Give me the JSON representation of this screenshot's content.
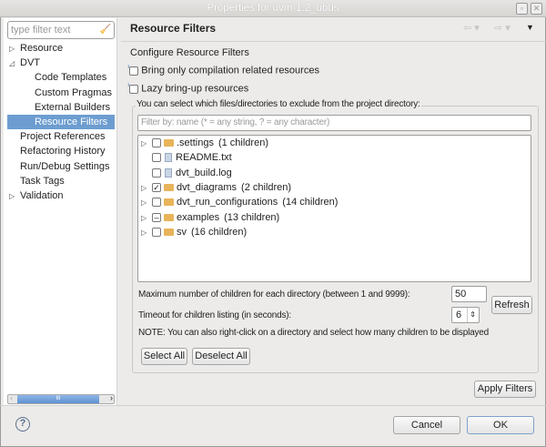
{
  "window": {
    "title": "Properties for uvm-1.2_ubus"
  },
  "sidebar": {
    "filter_placeholder": "type filter text",
    "items": [
      {
        "label": "Resource",
        "expandable": true
      },
      {
        "label": "DVT",
        "expanded": true
      },
      {
        "label": "Code Templates"
      },
      {
        "label": "Custom Pragmas"
      },
      {
        "label": "External Builders"
      },
      {
        "label": "Resource Filters",
        "selected": true
      },
      {
        "label": "Project References"
      },
      {
        "label": "Refactoring History"
      },
      {
        "label": "Run/Debug Settings"
      },
      {
        "label": "Task Tags"
      },
      {
        "label": "Validation",
        "expandable": true
      }
    ]
  },
  "header": {
    "title": "Resource Filters"
  },
  "main": {
    "section_title": "Configure Resource Filters",
    "bring_only_label": "Bring only compilation related resources",
    "lazy_label": "Lazy bring-up resources",
    "group_label": "You can select which files/directories to exclude from the project directory:",
    "filter_placeholder": "Filter by: name (* = any string, ? = any character)",
    "tree": [
      {
        "name": ".settings",
        "count": "(1 children)",
        "type": "folder",
        "check": "unchecked"
      },
      {
        "name": "README.txt",
        "count": "",
        "type": "file",
        "check": "unchecked"
      },
      {
        "name": "dvt_build.log",
        "count": "",
        "type": "file",
        "check": "unchecked"
      },
      {
        "name": "dvt_diagrams",
        "count": "(2 children)",
        "type": "folder",
        "check": "checked"
      },
      {
        "name": "dvt_run_configurations",
        "count": "(14 children)",
        "type": "folder",
        "check": "unchecked"
      },
      {
        "name": "examples",
        "count": "(13 children)",
        "type": "folder",
        "check": "partial"
      },
      {
        "name": "sv",
        "count": "(16 children)",
        "type": "folder",
        "check": "unchecked"
      }
    ],
    "max_children_label": "Maximum number of children for each directory (between 1 and 9999):",
    "max_children_value": "50",
    "refresh_label": "Refresh",
    "timeout_label": "Timeout for children listing (in seconds):",
    "timeout_value": "6",
    "note": "NOTE: You can also right-click on a directory and select how many children to be displayed",
    "select_all": "Select All",
    "deselect_all": "Deselect All",
    "apply_filters": "Apply Filters"
  },
  "footer": {
    "cancel": "Cancel",
    "ok": "OK"
  }
}
